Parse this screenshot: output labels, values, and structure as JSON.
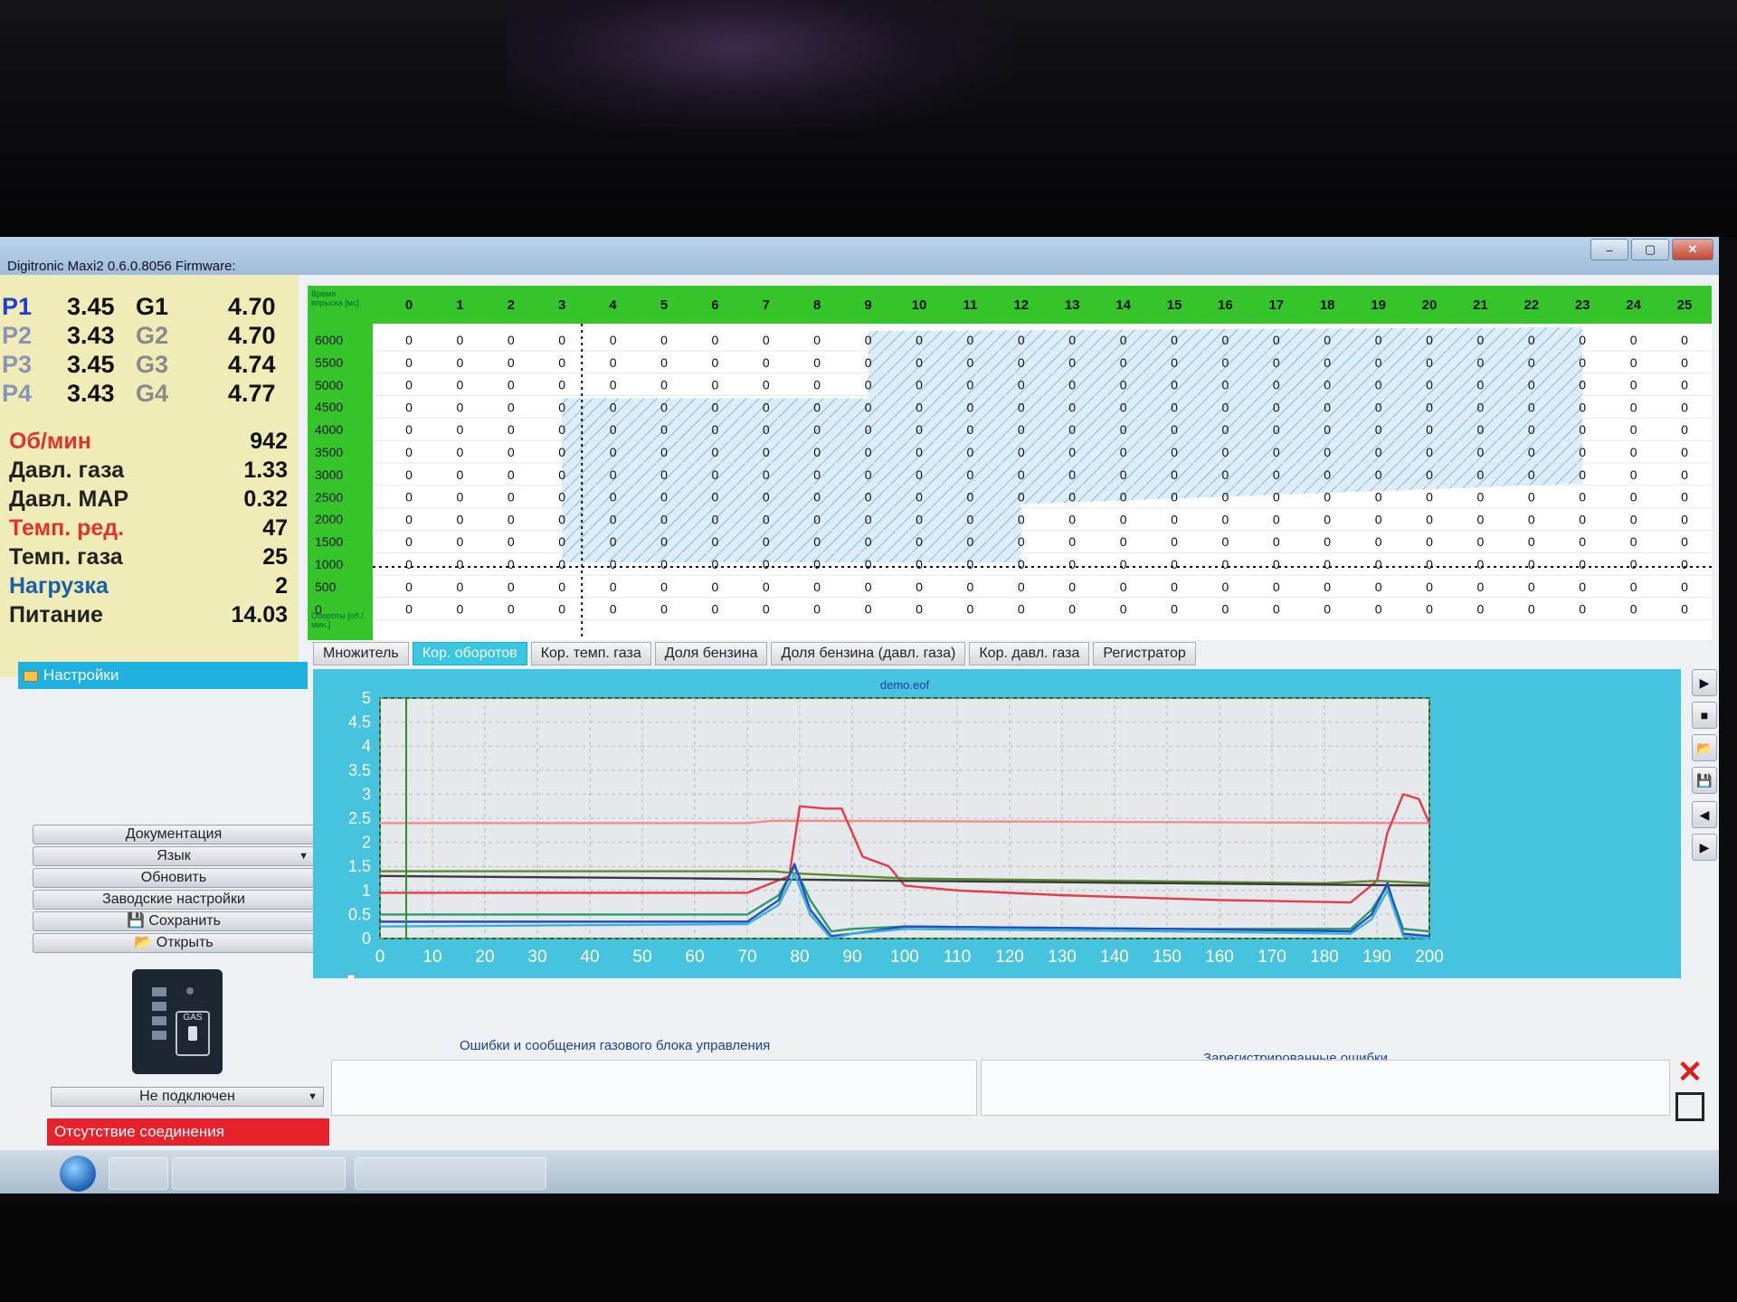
{
  "window": {
    "title": "Digitronic Maxi2 0.6.0.8056 Firmware:",
    "buttons": [
      "–",
      "▢",
      "✕"
    ]
  },
  "injectors": [
    {
      "p_label": "P1",
      "p_value": "3.45",
      "g_label": "G1",
      "g_value": "4.70"
    },
    {
      "p_label": "P2",
      "p_value": "3.43",
      "g_label": "G2",
      "g_value": "4.70"
    },
    {
      "p_label": "P3",
      "p_value": "3.45",
      "g_label": "G3",
      "g_value": "4.74"
    },
    {
      "p_label": "P4",
      "p_value": "3.43",
      "g_label": "G4",
      "g_value": "4.77"
    }
  ],
  "params": [
    {
      "label": "Об/мин",
      "value": "942",
      "color": "#e0332a"
    },
    {
      "label": "Давл. газа",
      "value": "1.33",
      "color": "#222222"
    },
    {
      "label": "Давл. MAP",
      "value": "0.32",
      "color": "#222222"
    },
    {
      "label": "Темп. ред.",
      "value": "47",
      "color": "#e0332a"
    },
    {
      "label": "Темп. газа",
      "value": "25",
      "color": "#222222"
    },
    {
      "label": "Нагрузка",
      "value": "2",
      "color": "#1b5fa8"
    },
    {
      "label": "Питание",
      "value": "14.03",
      "color": "#222222"
    }
  ],
  "map": {
    "corner_top": "Время впрыска [мс]",
    "corner_bottom": "Обороты [об./мин.]",
    "columns": [
      "0",
      "1",
      "2",
      "3",
      "4",
      "5",
      "6",
      "7",
      "8",
      "9",
      "10",
      "11",
      "12",
      "13",
      "14",
      "15",
      "16",
      "17",
      "18",
      "19",
      "20",
      "21",
      "22",
      "23",
      "24",
      "25"
    ],
    "rows": [
      "6000",
      "5500",
      "5000",
      "4500",
      "4000",
      "3500",
      "3000",
      "2500",
      "2000",
      "1500",
      "1000",
      "500",
      "0"
    ],
    "cell_value": "0"
  },
  "tabs": [
    {
      "label": "Множитель",
      "active": false
    },
    {
      "label": "Кор. оборотов",
      "active": true
    },
    {
      "label": "Кор. темп. газа",
      "active": false
    },
    {
      "label": "Доля бензина",
      "active": false
    },
    {
      "label": "Доля бензина (давл. газа)",
      "active": false
    },
    {
      "label": "Кор. давл. газа",
      "active": false
    },
    {
      "label": "Регистратор",
      "active": false
    }
  ],
  "sidebar": {
    "settings_label": "Настройки",
    "buttons": [
      "Документация",
      "Язык",
      "Обновить",
      "Заводские настройки",
      "Сохранить",
      "Открыть"
    ],
    "device_label": "GAS",
    "connection_select": "Не подключен",
    "connection_status": "Отсутствие соединения"
  },
  "log": {
    "file_title": "demo.eof"
  },
  "errors": {
    "ecu_title": "Ошибки и сообщения газового блока управления",
    "registered_title": "Зарегистрированные ошибки"
  },
  "chart_data": {
    "type": "line",
    "title": "demo.eof",
    "xlim": [
      0,
      200
    ],
    "ylim": [
      0,
      5
    ],
    "xticks": [
      "0",
      "10",
      "20",
      "30",
      "40",
      "50",
      "60",
      "70",
      "80",
      "90",
      "100",
      "110",
      "120",
      "130",
      "140",
      "150",
      "160",
      "170",
      "180",
      "190",
      "200"
    ],
    "yticks": [
      "0",
      "0.5",
      "1",
      "1.5",
      "2",
      "2.5",
      "3",
      "3.5",
      "4",
      "4.5",
      "5"
    ],
    "grid": true,
    "cursor_x": 5,
    "series": [
      {
        "color": "#f08c8c",
        "x": [
          0,
          70,
          75,
          200
        ],
        "y": [
          2.4,
          2.4,
          2.45,
          2.4
        ]
      },
      {
        "color": "#e83a4a",
        "x": [
          0,
          70,
          78,
          80,
          85,
          88,
          92,
          97,
          100,
          110,
          130,
          160,
          185,
          190,
          192,
          195,
          198,
          200
        ],
        "y": [
          0.95,
          0.95,
          1.3,
          2.75,
          2.7,
          2.7,
          1.7,
          1.5,
          1.1,
          1.0,
          0.9,
          0.8,
          0.75,
          1.2,
          2.2,
          3.0,
          2.9,
          2.4
        ]
      },
      {
        "color": "#5d8a2e",
        "x": [
          0,
          70,
          75,
          80,
          90,
          100,
          140,
          180,
          190,
          200
        ],
        "y": [
          1.4,
          1.4,
          1.4,
          1.35,
          1.3,
          1.25,
          1.2,
          1.15,
          1.2,
          1.15
        ]
      },
      {
        "color": "#3b3b3b",
        "x": [
          0,
          60,
          100,
          150,
          200
        ],
        "y": [
          1.3,
          1.25,
          1.2,
          1.15,
          1.1
        ]
      },
      {
        "color": "#2a9a6e",
        "x": [
          0,
          70,
          76,
          79,
          82,
          86,
          90,
          100,
          150,
          185,
          189,
          192,
          195,
          200
        ],
        "y": [
          0.5,
          0.5,
          0.9,
          1.5,
          0.8,
          0.15,
          0.2,
          0.25,
          0.2,
          0.2,
          0.6,
          1.1,
          0.2,
          0.15
        ]
      },
      {
        "color": "#1f4fc2",
        "x": [
          0,
          70,
          76,
          79,
          82,
          86,
          90,
          100,
          150,
          185,
          189,
          192,
          195,
          200
        ],
        "y": [
          0.35,
          0.35,
          0.8,
          1.55,
          0.6,
          0.05,
          0.1,
          0.25,
          0.2,
          0.15,
          0.5,
          1.15,
          0.1,
          0.05
        ]
      },
      {
        "color": "#3ab0d8",
        "x": [
          0,
          70,
          76,
          79,
          82,
          86,
          90,
          100,
          150,
          185,
          189,
          192,
          195,
          200
        ],
        "y": [
          0.25,
          0.3,
          0.7,
          1.35,
          0.5,
          0.0,
          0.1,
          0.2,
          0.15,
          0.1,
          0.4,
          1.0,
          0.05,
          0.0
        ]
      }
    ]
  },
  "colors": {
    "map_header": "#35c52a",
    "log_panel": "#46c4df",
    "active_tab": "#38c6e0",
    "no_connection": "#e8222a"
  }
}
